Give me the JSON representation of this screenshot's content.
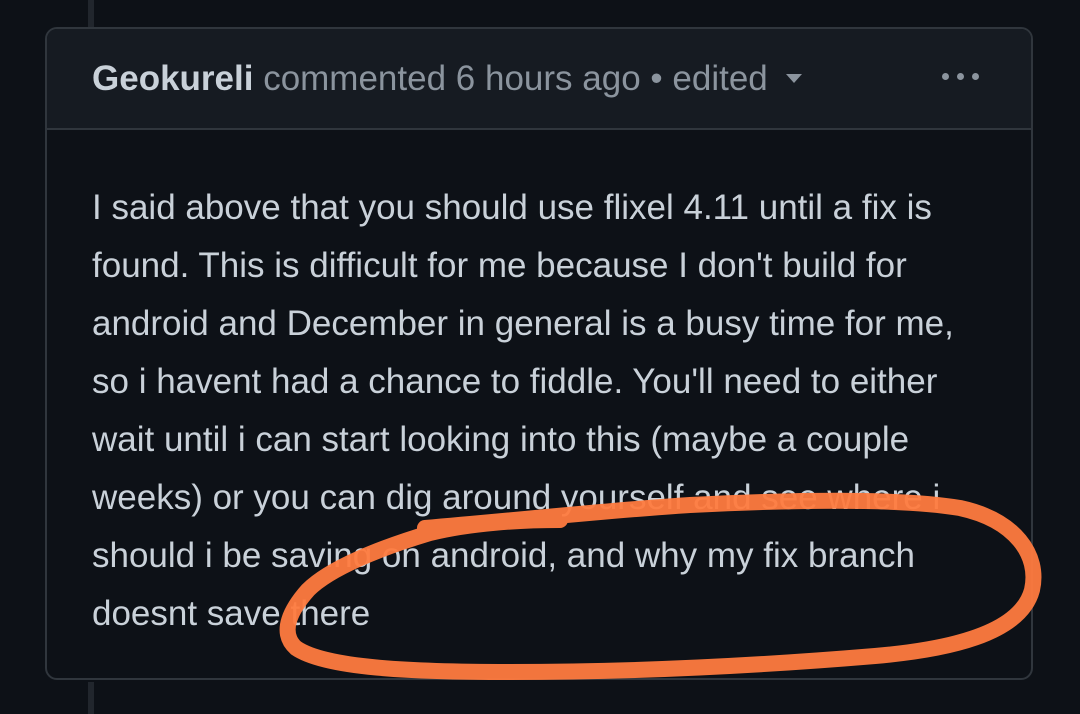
{
  "comment": {
    "author": "Geokureli",
    "action": "commented",
    "time": "6 hours ago",
    "separator": "•",
    "edited": "edited",
    "more_menu_icon": "kebab-horizontal-icon",
    "body": "I said above that you should use flixel 4.11 until a fix is found. This is difficult for me because I don't build for android and December in general is a busy time for me, so i havent had a chance to fiddle. You'll need to either wait until i can start looking into this (maybe a couple weeks) or you can dig around yourself and see where i should i be saving on android, and why my fix branch doesnt save there"
  },
  "colors": {
    "background": "#0d1117",
    "header_background": "#161b22",
    "border": "#30363d",
    "text": "#c9d1d9",
    "muted_text": "#8b949e",
    "annotation": "#ff7b3f"
  }
}
